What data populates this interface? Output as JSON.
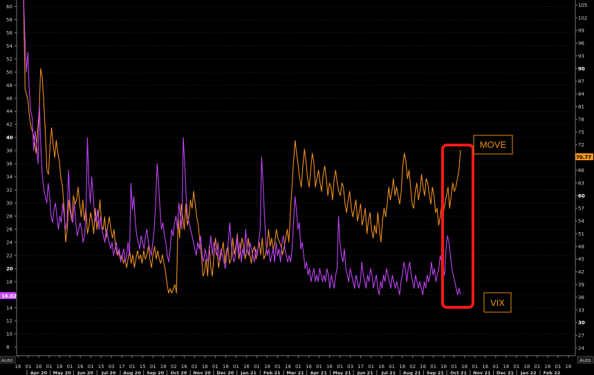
{
  "chart_data": {
    "type": "line",
    "x_month_labels": [
      "Apr 20",
      "May 20",
      "Jun 20",
      "Jul 20",
      "Aug 20",
      "Sep 20",
      "Oct 20",
      "Nov 20",
      "Dec 20",
      "Jan 21",
      "Feb 21",
      "Mar 21",
      "Apr 21",
      "May 21",
      "Jun 21",
      "Jul 21",
      "Aug 21",
      "Sep 21",
      "Oct 21",
      "Nov 21",
      "Dec 21",
      "Jan 22",
      "Feb 22"
    ],
    "x_day_ticks": [
      "16",
      "01",
      "16",
      "01",
      "18",
      "01",
      "16",
      "01",
      "15",
      "03",
      "17",
      "01",
      "15",
      "01",
      "18",
      "02",
      "16",
      "01",
      "16",
      "01",
      "18",
      "01",
      "16",
      "01",
      "18",
      "01",
      "18",
      "01",
      "16",
      "01",
      "16",
      "01",
      "03",
      "17",
      "01",
      "16",
      "01",
      "18",
      "02",
      "16",
      "01",
      "16",
      "01",
      "18",
      "01",
      "16",
      "01",
      "16",
      "01",
      "18",
      "01",
      "16",
      "01",
      "16"
    ],
    "left_axis": {
      "ticks": [
        8,
        10,
        12,
        14,
        16,
        18,
        20,
        22,
        24,
        26,
        28,
        30,
        32,
        34,
        36,
        38,
        40,
        42,
        44,
        46,
        48,
        50,
        52,
        54,
        56,
        58,
        60
      ],
      "ylim": [
        6.7,
        61
      ]
    },
    "right_axis": {
      "ticks": [
        24,
        27,
        30,
        33,
        36,
        39,
        42,
        45,
        48,
        51,
        54,
        57,
        60,
        63,
        66,
        69,
        72,
        75,
        78,
        81,
        84,
        87,
        90,
        93,
        96,
        99,
        102,
        105
      ],
      "ylim": [
        22.2,
        106.2
      ]
    },
    "last_value_badges": {
      "VIX": "16.02",
      "MOVE": "70.77"
    },
    "axis_auto_labels": {
      "left": "Auto",
      "right": "Auto"
    },
    "annotations": {
      "move_label": "MOVE",
      "vix_label": "VIX"
    },
    "series": [
      {
        "name": "MOVE",
        "axis": "right",
        "color": "#f7941d",
        "values": [
          140,
          85,
          84,
          82,
          78,
          76,
          75,
          73,
          70,
          75,
          80,
          90,
          88,
          82,
          75,
          66,
          65,
          72,
          76,
          72,
          69,
          73,
          70,
          68,
          64,
          62,
          57,
          49,
          52,
          59,
          56,
          54,
          60,
          58,
          59,
          62,
          58,
          55,
          59,
          54,
          57,
          51,
          53,
          56,
          54,
          51,
          57,
          52,
          55,
          59,
          53,
          52,
          55,
          50,
          53,
          55,
          52,
          50,
          52,
          48,
          46,
          47,
          45,
          46,
          44,
          45,
          43,
          45,
          47,
          44,
          46,
          43,
          45,
          47,
          45,
          46,
          44,
          47,
          45,
          46,
          48,
          45,
          43,
          46,
          48,
          45,
          47,
          45,
          44,
          46,
          44,
          42,
          39,
          37,
          38,
          37,
          38,
          39,
          37,
          55,
          50,
          58,
          55,
          52,
          58,
          53,
          55,
          59,
          57,
          61,
          58,
          55,
          53,
          49,
          46,
          41,
          42,
          45,
          41,
          48,
          43,
          41,
          46,
          50,
          47,
          43,
          45,
          47,
          49,
          44,
          47,
          48,
          44,
          45,
          50,
          46,
          48,
          51,
          45,
          47,
          50,
          48,
          45,
          47,
          50,
          46,
          44,
          47,
          48,
          45,
          47,
          49,
          46,
          50,
          45,
          46,
          48,
          52,
          48,
          50,
          47,
          49,
          52,
          50,
          49,
          48,
          46,
          48,
          50,
          52,
          49,
          56,
          62,
          68,
          73,
          70,
          67,
          64,
          62,
          67,
          71,
          68,
          64,
          62,
          66,
          70,
          68,
          62,
          64,
          66,
          63,
          61,
          65,
          67,
          64,
          60,
          63,
          62,
          59,
          64,
          66,
          63,
          61,
          60,
          63,
          62,
          58,
          56,
          59,
          61,
          57,
          55,
          57,
          59,
          54,
          56,
          58,
          53,
          55,
          57,
          51,
          54,
          56,
          52,
          50,
          53,
          51,
          56,
          52,
          49,
          54,
          57,
          55,
          58,
          62,
          59,
          61,
          64,
          60,
          62,
          60,
          58,
          61,
          67,
          70,
          68,
          64,
          66,
          62,
          58,
          57,
          61,
          63,
          59,
          61,
          65,
          62,
          60,
          64,
          63,
          60,
          58,
          62,
          60,
          56,
          57,
          53,
          55,
          58,
          56,
          58,
          60,
          62,
          57,
          60,
          63,
          61,
          62,
          64,
          66,
          70.77
        ]
      },
      {
        "name": "VIX",
        "axis": "left",
        "color": "#c545ff",
        "values": [
          66,
          55,
          50,
          53,
          47,
          44,
          43,
          38,
          41,
          39,
          36,
          45,
          38,
          34,
          32,
          31,
          30,
          33,
          31,
          28,
          27,
          29,
          30,
          28,
          26,
          28,
          27,
          30,
          28,
          26,
          27,
          35,
          30,
          28,
          27,
          30,
          27,
          25,
          26,
          27,
          26,
          24,
          25,
          28,
          40,
          33,
          30,
          34,
          31,
          28,
          27,
          29,
          26,
          28,
          26,
          25,
          24,
          26,
          25,
          24,
          23,
          24,
          22,
          23,
          24,
          22,
          23,
          21,
          22,
          23,
          21,
          22,
          24,
          22,
          33,
          29,
          31,
          27,
          25,
          24,
          23,
          25,
          24,
          23,
          25,
          26,
          24,
          23,
          22,
          24,
          26,
          30,
          36,
          33,
          29,
          26,
          27,
          25,
          24,
          22,
          21,
          23,
          26,
          25,
          27,
          28,
          26,
          30,
          28,
          26,
          40,
          36,
          31,
          28,
          27,
          26,
          25,
          24,
          23,
          22,
          24,
          23,
          25,
          22,
          21,
          23,
          22,
          21,
          23,
          25,
          22,
          24,
          23,
          22,
          24,
          21,
          23,
          22,
          21,
          20,
          22,
          24,
          27,
          24,
          22,
          21,
          22,
          25,
          22,
          24,
          21,
          23,
          22,
          26,
          23,
          22,
          24,
          23,
          22,
          21,
          23,
          22,
          24,
          26,
          37,
          33,
          28,
          24,
          22,
          23,
          21,
          22,
          23,
          21,
          24,
          22,
          23,
          21,
          24,
          25,
          23,
          22,
          21,
          22,
          21,
          23,
          27,
          31,
          29,
          26,
          27,
          23,
          24,
          22,
          20,
          21,
          19,
          20,
          18,
          19,
          20,
          18,
          19,
          18,
          20,
          19,
          18,
          19,
          18,
          20,
          19,
          17,
          19,
          18,
          17,
          19,
          20,
          28,
          24,
          22,
          21,
          23,
          20,
          19,
          18,
          20,
          19,
          18,
          17,
          19,
          18,
          17,
          18,
          21,
          19,
          18,
          17,
          19,
          18,
          20,
          19,
          17,
          18,
          19,
          17,
          16,
          18,
          17,
          19,
          18,
          20,
          19,
          18,
          17,
          19,
          18,
          17,
          18,
          17,
          16,
          18,
          19,
          21,
          20,
          18,
          20,
          21,
          19,
          18,
          17,
          19,
          18,
          17,
          18,
          17,
          16,
          18,
          17,
          19,
          18,
          19,
          21,
          19,
          20,
          18,
          19,
          20,
          22,
          21,
          20,
          19,
          23,
          25,
          24,
          22,
          20,
          19,
          18,
          17,
          16,
          17,
          16.02
        ]
      }
    ]
  }
}
